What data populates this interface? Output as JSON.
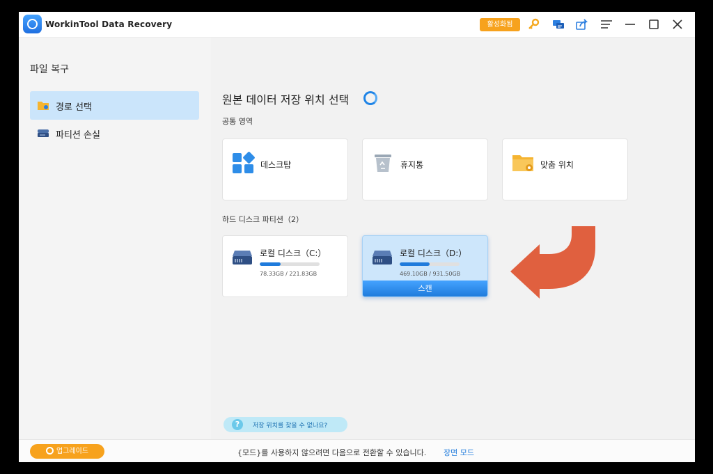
{
  "titlebar": {
    "app_title": "WorkinTool Data Recovery",
    "activate_label": "활성화됨",
    "icons": [
      "key-icon",
      "chat-icon",
      "share-icon",
      "menu-icon",
      "minimize-icon",
      "maximize-icon",
      "close-icon"
    ]
  },
  "sidebar": {
    "title": "파일 복구",
    "items": [
      {
        "label": "경로 선택",
        "icon": "folder-icon",
        "active": true
      },
      {
        "label": "파티션 손실",
        "icon": "drive-icon",
        "active": false
      }
    ]
  },
  "main": {
    "title": "원본 데이터 저장 위치 선택",
    "common_section_label": "공통 영역",
    "common_cards": [
      {
        "label": "데스크탑",
        "icon": "desktop-apps-icon"
      },
      {
        "label": "휴지통",
        "icon": "recycle-bin-icon"
      },
      {
        "label": "맞춤 위치",
        "icon": "custom-folder-icon"
      }
    ],
    "disk_section_label": "하드 디스크 파티션（2）",
    "disks": [
      {
        "label": "로컬 디스크（C:）",
        "size": "78.33GB / 221.83GB",
        "used_fraction": 0.353,
        "selected": false
      },
      {
        "label": "로컬 디스크（D:）",
        "size": "469.10GB / 931.50GB",
        "used_fraction": 0.504,
        "selected": true,
        "scan_label": "스캔"
      }
    ],
    "help_text": "저장 위치를 찾을 수 없나요?"
  },
  "footer": {
    "upgrade_label": "업그레이드",
    "message": "{모드}를 사용하지 않으려면 다음으로 전환할 수 있습니다.",
    "link_label": "장면 모드"
  },
  "colors": {
    "accent": "#1f7bdc",
    "orange": "#f7a21d",
    "arrow": "#e0603f",
    "selected_bg": "#cde6fb"
  }
}
